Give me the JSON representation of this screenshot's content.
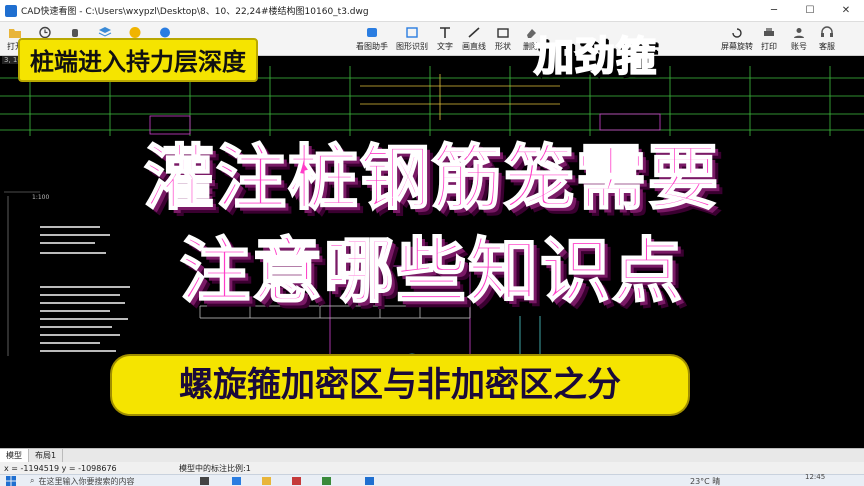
{
  "window": {
    "title": "CAD快速看图 - C:\\Users\\wxypzl\\Desktop\\8、10、22,24#楼结构图10160_t3.dwg",
    "minimize": "─",
    "maximize": "☐",
    "close": "✕"
  },
  "toolbar": {
    "items": [
      {
        "label": "打开",
        "icon": "folder-icon"
      },
      {
        "label": "",
        "icon": "clock-icon"
      },
      {
        "label": "",
        "icon": "hand-icon"
      },
      {
        "label": "",
        "icon": "layers-icon"
      },
      {
        "label": "",
        "icon": "vip-icon"
      },
      {
        "label": "",
        "icon": "help-icon"
      },
      {
        "label": "看图助手",
        "icon": "assistant-icon"
      },
      {
        "label": "图形识别",
        "icon": "recognize-icon"
      },
      {
        "label": "文字",
        "icon": "text-icon"
      },
      {
        "label": "画直线",
        "icon": "line-icon"
      },
      {
        "label": "形状",
        "icon": "shape-icon"
      },
      {
        "label": "删除",
        "icon": "eraser-icon"
      },
      {
        "label": "屏幕旋转",
        "icon": "rotate-icon"
      },
      {
        "label": "打印",
        "icon": "print-icon"
      },
      {
        "label": "账号",
        "icon": "account-icon"
      },
      {
        "label": "客服",
        "icon": "support-icon"
      }
    ]
  },
  "canvas": {
    "corner_text": "3, 10,",
    "scale_label": "1:100",
    "background": "#000000"
  },
  "overlays": {
    "tag_left": "桩端进入持力层深度",
    "tag_right": "加劲箍",
    "headline_1": "灌注桩钢筋笼需要",
    "headline_2": "注意哪些知识点",
    "subtitle": "螺旋箍加密区与非加密区之分",
    "colors": {
      "headline": "#ff3cc8",
      "tag": "#f5e400",
      "tag_right": "#2a6fd6"
    }
  },
  "tabs": [
    "模型",
    "布局1"
  ],
  "status": {
    "coords": "x = -1194519  y = -1098676",
    "scale_text": "模型中的标注比例:1"
  },
  "taskbar": {
    "search_placeholder": "在这里输入你要搜索的内容",
    "weather": "23°C 晴",
    "time": "12:45",
    "date": ""
  }
}
